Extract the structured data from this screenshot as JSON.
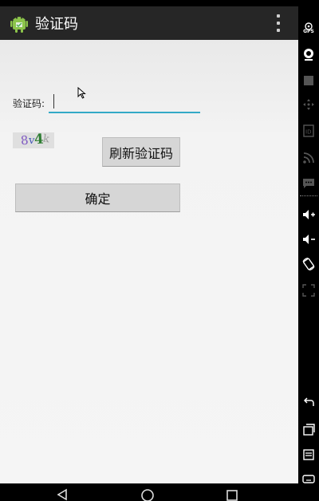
{
  "app": {
    "title": "验证码"
  },
  "form": {
    "code_label": "验证码:",
    "code_input_value": "",
    "captcha_chars": [
      "8",
      "v",
      "4",
      "k"
    ],
    "refresh_label": "刷新验证码",
    "confirm_label": "确定"
  },
  "sidebar": {
    "gps_label": "GPS"
  },
  "colors": {
    "actionbar": "#262626",
    "input_underline": "#33a9c6",
    "button_bg": "#d6d6d6",
    "content_bg": "#f5f5f5"
  }
}
